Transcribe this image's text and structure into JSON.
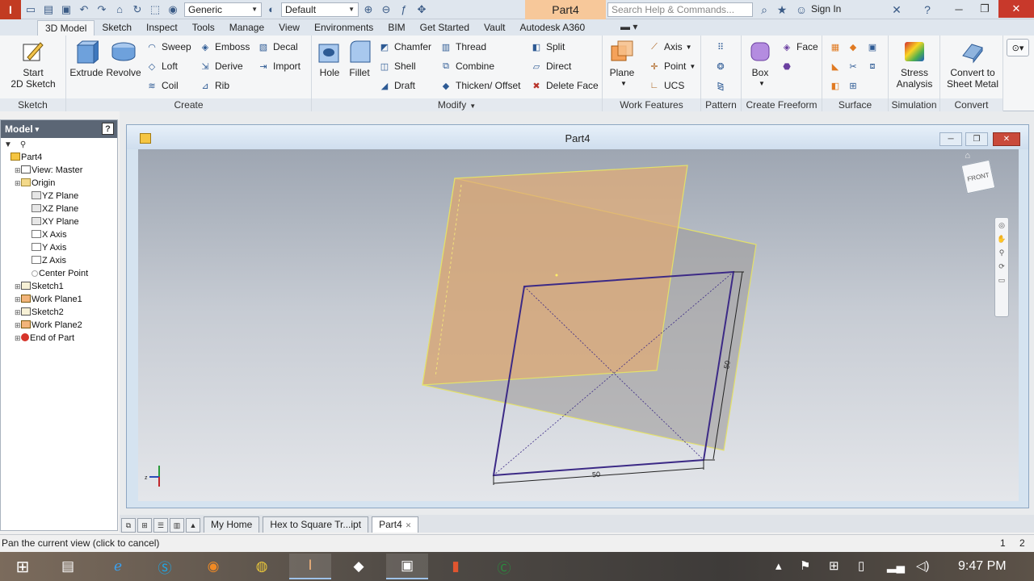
{
  "quick_access": {
    "material_value": "Generic",
    "appearance_value": "Default",
    "doc_title": "Part4",
    "search_placeholder": "Search Help & Commands...",
    "sign_in": "Sign In"
  },
  "ribbon_tabs": [
    "3D Model",
    "Sketch",
    "Inspect",
    "Tools",
    "Manage",
    "View",
    "Environments",
    "BIM",
    "Get Started",
    "Vault",
    "Autodesk A360"
  ],
  "ribbon": {
    "sketch": {
      "title": "Sketch",
      "start": "Start",
      "start2": "2D Sketch"
    },
    "create": {
      "title": "Create",
      "extrude": "Extrude",
      "revolve": "Revolve",
      "sweep": "Sweep",
      "loft": "Loft",
      "coil": "Coil",
      "emboss": "Emboss",
      "derive": "Derive",
      "rib": "Rib",
      "decal": "Decal",
      "import": "Import"
    },
    "modify": {
      "title": "Modify",
      "hole": "Hole",
      "fillet": "Fillet",
      "chamfer": "Chamfer",
      "shell": "Shell",
      "draft": "Draft",
      "thread": "Thread",
      "combine": "Combine",
      "thicken": "Thicken/ Offset",
      "split": "Split",
      "direct": "Direct",
      "delete_face": "Delete Face"
    },
    "work_features": {
      "title": "Work Features",
      "plane": "Plane",
      "axis": "Axis",
      "point": "Point",
      "ucs": "UCS"
    },
    "pattern": {
      "title": "Pattern"
    },
    "freeform": {
      "title": "Create Freeform",
      "box": "Box",
      "face": "Face"
    },
    "surface": {
      "title": "Surface"
    },
    "simulation": {
      "title": "Simulation",
      "stress": "Stress",
      "analysis": "Analysis"
    },
    "convert": {
      "title": "Convert",
      "l1": "Convert to",
      "l2": "Sheet Metal"
    }
  },
  "browser": {
    "header": "Model",
    "tree": [
      {
        "label": "Part4",
        "indent": 0,
        "icon": "part-icon"
      },
      {
        "label": "View: Master",
        "indent": 1,
        "icon": "view-icon"
      },
      {
        "label": "Origin",
        "indent": 1,
        "icon": "folder-icon"
      },
      {
        "label": "YZ Plane",
        "indent": 2,
        "icon": "plane-icon"
      },
      {
        "label": "XZ Plane",
        "indent": 2,
        "icon": "plane-icon"
      },
      {
        "label": "XY Plane",
        "indent": 2,
        "icon": "plane-icon"
      },
      {
        "label": "X Axis",
        "indent": 2,
        "icon": "axis-icon"
      },
      {
        "label": "Y Axis",
        "indent": 2,
        "icon": "axis-icon"
      },
      {
        "label": "Z Axis",
        "indent": 2,
        "icon": "axis-icon"
      },
      {
        "label": "Center Point",
        "indent": 2,
        "icon": "point-icon"
      },
      {
        "label": "Sketch1",
        "indent": 1,
        "icon": "sketch-icon"
      },
      {
        "label": "Work Plane1",
        "indent": 1,
        "icon": "workplane-icon"
      },
      {
        "label": "Sketch2",
        "indent": 1,
        "icon": "sketch-icon"
      },
      {
        "label": "Work Plane2",
        "indent": 1,
        "icon": "workplane-icon"
      },
      {
        "label": "End of Part",
        "indent": 1,
        "icon": "end-icon"
      }
    ]
  },
  "graphics": {
    "title": "Part4",
    "dim_horizontal": "50",
    "dim_vertical": "50",
    "viewcube_label": "FRONT"
  },
  "doc_tabs": [
    "My Home",
    "Hex to Square Tr...ipt",
    "Part4"
  ],
  "status": {
    "message": "Pan the current view (click to cancel)",
    "n1": "1",
    "n2": "2"
  },
  "taskbar": {
    "clock": "9:47 PM"
  },
  "colors": {
    "accent": "#c23b22",
    "doc_tab_orange": "#f7c89a",
    "workplane_fill": "#e0aa74",
    "sketch_line": "#3c2a86"
  }
}
